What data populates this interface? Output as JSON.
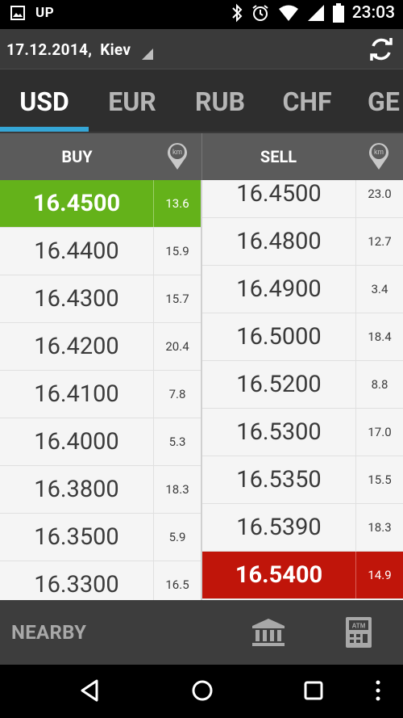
{
  "status_bar": {
    "up_label": "UP",
    "time": "23:03",
    "icons": [
      "image-icon",
      "bluetooth-icon",
      "alarm-icon",
      "wifi-icon",
      "signal-icon",
      "battery-icon"
    ]
  },
  "header": {
    "date": "17.12.2014,",
    "city": "Kiev"
  },
  "tabs": [
    {
      "label": "USD",
      "active": true
    },
    {
      "label": "EUR",
      "active": false
    },
    {
      "label": "RUB",
      "active": false
    },
    {
      "label": "CHF",
      "active": false
    },
    {
      "label": "GE",
      "active": false
    }
  ],
  "table": {
    "buy_header": "BUY",
    "sell_header": "SELL",
    "km_label": "km",
    "buy_rows": [
      {
        "rate": "16.4500",
        "dist": "13.6",
        "best": true
      },
      {
        "rate": "16.4400",
        "dist": "15.9"
      },
      {
        "rate": "16.4300",
        "dist": "15.7"
      },
      {
        "rate": "16.4200",
        "dist": "20.4"
      },
      {
        "rate": "16.4100",
        "dist": "7.8"
      },
      {
        "rate": "16.4000",
        "dist": "5.3"
      },
      {
        "rate": "16.3800",
        "dist": "18.3"
      },
      {
        "rate": "16.3500",
        "dist": "5.9"
      },
      {
        "rate": "16.3300",
        "dist": "16.5"
      }
    ],
    "sell_rows": [
      {
        "rate": "16.4500",
        "dist": "23.0"
      },
      {
        "rate": "16.4800",
        "dist": "12.7"
      },
      {
        "rate": "16.4900",
        "dist": "3.4"
      },
      {
        "rate": "16.5000",
        "dist": "18.4"
      },
      {
        "rate": "16.5200",
        "dist": "8.8"
      },
      {
        "rate": "16.5300",
        "dist": "17.0"
      },
      {
        "rate": "16.5350",
        "dist": "15.5"
      },
      {
        "rate": "16.5390",
        "dist": "18.3"
      },
      {
        "rate": "16.5400",
        "dist": "14.9",
        "best": true
      }
    ]
  },
  "bottom_bar": {
    "nearby_label": "NEARBY",
    "atm_label": "ATM"
  },
  "colors": {
    "accent": "#35a6d6",
    "best_buy": "#64b21a",
    "best_sell": "#c0150a"
  }
}
